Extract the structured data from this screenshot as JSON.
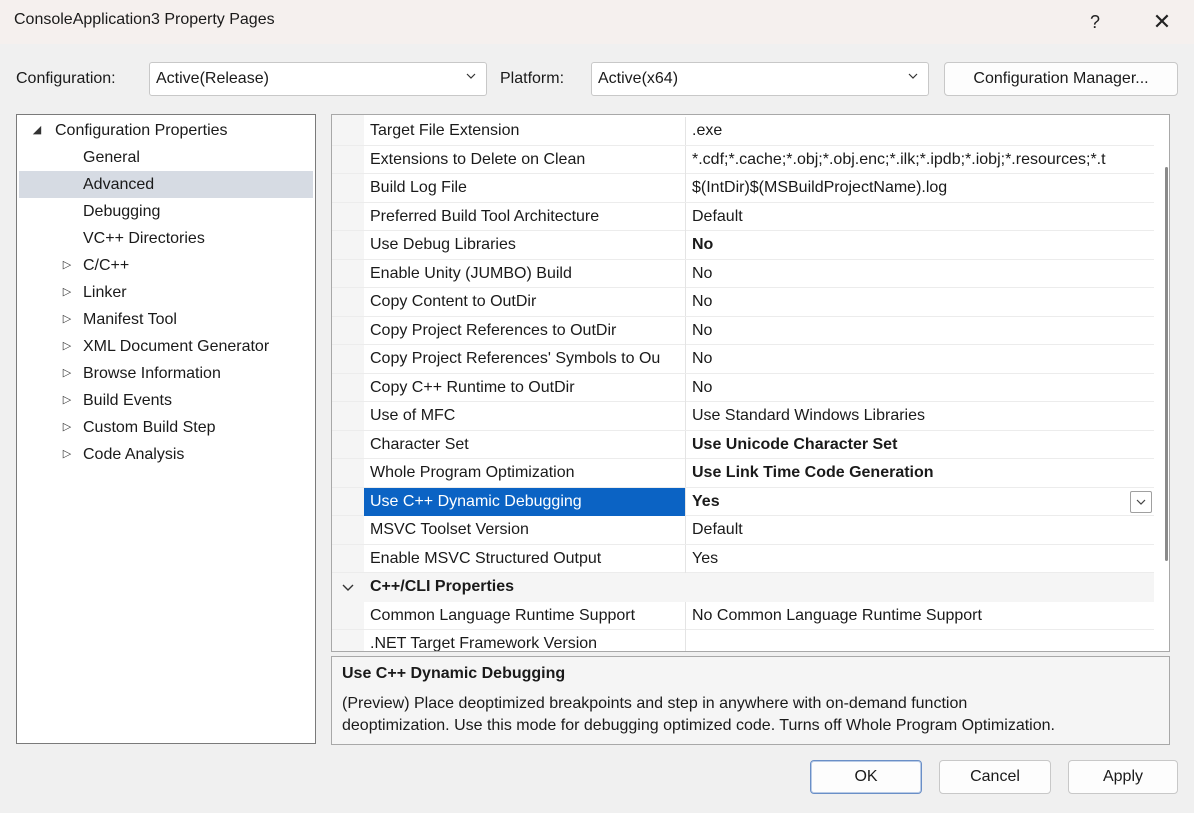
{
  "window": {
    "title": "ConsoleApplication3 Property Pages",
    "help_glyph": "?",
    "close_glyph": "✕"
  },
  "config": {
    "configuration_label": "Configuration:",
    "configuration_value": "Active(Release)",
    "platform_label": "Platform:",
    "platform_value": "Active(x64)",
    "manager_button": "Configuration Manager..."
  },
  "tree": {
    "root": {
      "label": "Configuration Properties",
      "arrow": "◢"
    },
    "items": [
      {
        "label": "General",
        "arrow": ""
      },
      {
        "label": "Advanced",
        "arrow": "",
        "selected": true
      },
      {
        "label": "Debugging",
        "arrow": ""
      },
      {
        "label": "VC++ Directories",
        "arrow": ""
      },
      {
        "label": "C/C++",
        "arrow": "▷"
      },
      {
        "label": "Linker",
        "arrow": "▷"
      },
      {
        "label": "Manifest Tool",
        "arrow": "▷"
      },
      {
        "label": "XML Document Generator",
        "arrow": "▷"
      },
      {
        "label": "Browse Information",
        "arrow": "▷"
      },
      {
        "label": "Build Events",
        "arrow": "▷"
      },
      {
        "label": "Custom Build Step",
        "arrow": "▷"
      },
      {
        "label": "Code Analysis",
        "arrow": "▷"
      }
    ]
  },
  "properties": [
    {
      "name": "Target File Extension",
      "value": ".exe",
      "bold": false
    },
    {
      "name": "Extensions to Delete on Clean",
      "value": "*.cdf;*.cache;*.obj;*.obj.enc;*.ilk;*.ipdb;*.iobj;*.resources;*.t",
      "bold": false
    },
    {
      "name": "Build Log File",
      "value": "$(IntDir)$(MSBuildProjectName).log",
      "bold": false
    },
    {
      "name": "Preferred Build Tool Architecture",
      "value": "Default",
      "bold": false
    },
    {
      "name": "Use Debug Libraries",
      "value": "No",
      "bold": true
    },
    {
      "name": "Enable Unity (JUMBO) Build",
      "value": "No",
      "bold": false
    },
    {
      "name": "Copy Content to OutDir",
      "value": "No",
      "bold": false
    },
    {
      "name": "Copy Project References to OutDir",
      "value": "No",
      "bold": false
    },
    {
      "name": "Copy Project References' Symbols to Ou",
      "value": "No",
      "bold": false
    },
    {
      "name": "Copy C++ Runtime to OutDir",
      "value": "No",
      "bold": false
    },
    {
      "name": "Use of MFC",
      "value": "Use Standard Windows Libraries",
      "bold": false
    },
    {
      "name": "Character Set",
      "value": "Use Unicode Character Set",
      "bold": true
    },
    {
      "name": "Whole Program Optimization",
      "value": "Use Link Time Code Generation",
      "bold": true
    },
    {
      "name": "Use C++ Dynamic Debugging",
      "value": "Yes",
      "bold": true,
      "selected": true
    },
    {
      "name": "MSVC Toolset Version",
      "value": "Default",
      "bold": false
    },
    {
      "name": "Enable MSVC Structured Output",
      "value": "Yes",
      "bold": false
    }
  ],
  "category": {
    "label": "C++/CLI Properties"
  },
  "cli_properties": [
    {
      "name": "Common Language Runtime Support",
      "value": "No Common Language Runtime Support",
      "bold": false
    },
    {
      "name": ".NET Target Framework Version",
      "value": "",
      "bold": false
    }
  ],
  "description": {
    "title": "Use C++ Dynamic Debugging",
    "line1": "(Preview) Place deoptimized breakpoints and step in anywhere with on-demand function",
    "line2": "deoptimization. Use this mode for debugging optimized code. Turns off Whole Program Optimization."
  },
  "buttons": {
    "ok": "OK",
    "cancel": "Cancel",
    "apply": "Apply"
  },
  "colors": {
    "selection": "#0b63c4",
    "tree_selection": "#d6dbe3"
  }
}
